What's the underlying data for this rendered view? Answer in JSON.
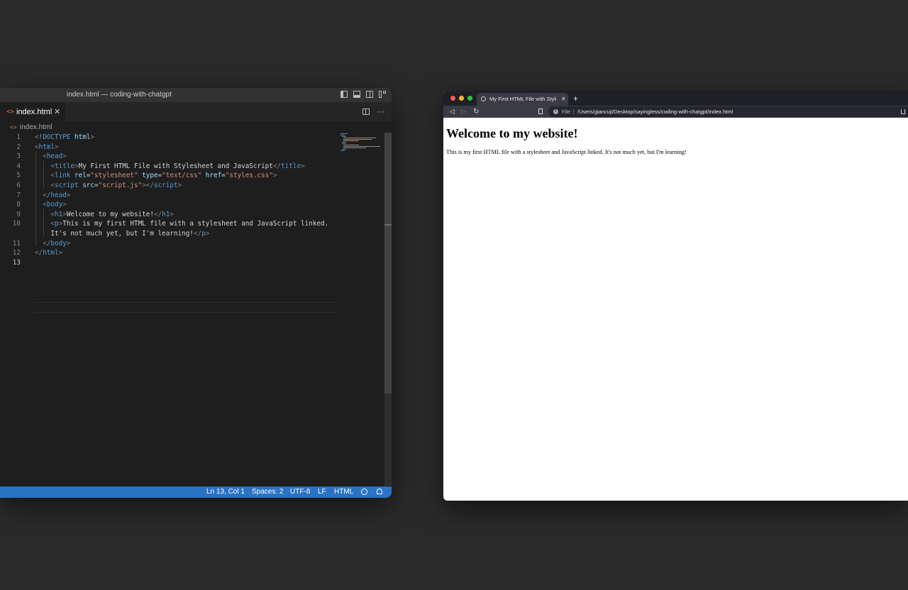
{
  "editor": {
    "window_title": "index.html — coding-with-chatgpt",
    "tab": {
      "file_icon": "<>",
      "label": "index.html",
      "close": "✕"
    },
    "tab_actions": {
      "more": "···"
    },
    "breadcrumb": {
      "file_icon": "<>",
      "label": "index.html"
    },
    "code_lines": [
      {
        "n": "1"
      },
      {
        "n": "2"
      },
      {
        "n": "3"
      },
      {
        "n": "4"
      },
      {
        "n": "5"
      },
      {
        "n": "6"
      },
      {
        "n": "7"
      },
      {
        "n": "8"
      },
      {
        "n": "9"
      },
      {
        "n": "10"
      },
      {
        "n": ""
      },
      {
        "n": "11"
      },
      {
        "n": "12"
      },
      {
        "n": "13"
      }
    ],
    "status": {
      "position": "Ln 13, Col 1",
      "indent": "Spaces: 2",
      "encoding": "UTF-8",
      "eol": "LF",
      "language": "HTML"
    },
    "icons": [
      "toggle-sidebar-icon",
      "toggle-panel-icon",
      "split-layout-icon",
      "customize-layout-icon",
      "split-editor-icon",
      "more-actions-icon",
      "feedback-icon",
      "bell-icon"
    ]
  },
  "browser": {
    "tab_title": "My First HTML File with Stylesheet and JavaScript",
    "tab_close": "✕",
    "new_tab": "+",
    "nav": {
      "back": "◁",
      "forward": "▷",
      "reload": "↻"
    },
    "address": {
      "scheme_label": "File",
      "url": "/Users/giancuji/Desktop/sayingless/coding-with-chatgpt/index.html"
    },
    "page": {
      "heading": "Welcome to my website!",
      "paragraph": "This is my first HTML file with a stylesheet and JavaScript linked. It's not much yet, but I'm learning!"
    },
    "traffic_lights": {
      "close": "#fe5f57",
      "minimize": "#febc2e",
      "maximize": "#28c840"
    }
  },
  "colors": {
    "desktop": "#2a2a2a",
    "statusbar": "#2a72c4",
    "tag": "#569cd6",
    "attr": "#9cdcfe",
    "string": "#ce9178"
  }
}
